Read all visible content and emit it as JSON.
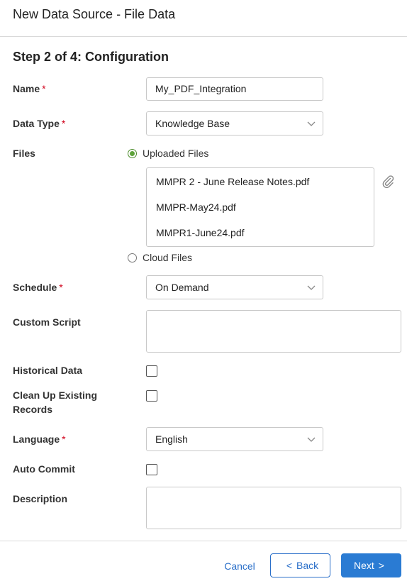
{
  "header": {
    "title": "New Data Source - File Data"
  },
  "step": {
    "title": "Step 2 of 4: Configuration"
  },
  "required_mark": "*",
  "form": {
    "name": {
      "label": "Name",
      "value": "My_PDF_Integration"
    },
    "data_type": {
      "label": "Data Type",
      "value": "Knowledge Base"
    },
    "files": {
      "label": "Files",
      "uploaded_label": "Uploaded Files",
      "uploaded_selected": true,
      "cloud_label": "Cloud Files",
      "items": [
        "MMPR 2 - June Release Notes.pdf",
        "MMPR-May24.pdf",
        "MMPR1-June24.pdf"
      ]
    },
    "schedule": {
      "label": "Schedule",
      "value": "On Demand"
    },
    "custom_script": {
      "label": "Custom Script",
      "value": ""
    },
    "historical_data": {
      "label": "Historical Data",
      "checked": false
    },
    "clean_up": {
      "label_line1": "Clean Up Existing",
      "label_line2": "Records",
      "checked": false
    },
    "language": {
      "label": "Language",
      "value": "English"
    },
    "auto_commit": {
      "label": "Auto Commit",
      "checked": false
    },
    "description": {
      "label": "Description",
      "value": ""
    }
  },
  "footer": {
    "cancel_label": "Cancel",
    "back_label": "Back",
    "back_arrow": "<",
    "next_label": "Next",
    "next_arrow": ">"
  },
  "icons": {
    "dropdown": "chevron-down-icon",
    "attach": "paperclip-icon"
  },
  "colors": {
    "primary": "#2a7bd3",
    "link": "#2a6fc9",
    "required": "#d0021b",
    "radio_selected": "#5ea33a"
  }
}
